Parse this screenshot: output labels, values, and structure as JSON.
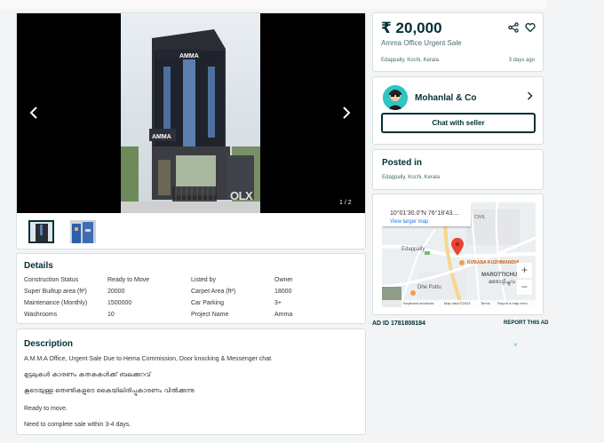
{
  "listing": {
    "price": "₹ 20,000",
    "title": "Amma Office Urgent Sale",
    "location": "Edappally, Kochi, Kerala",
    "posted_ago": "3 days ago"
  },
  "gallery": {
    "counter": "1 / 2",
    "watermark": "OLX",
    "building_sign_top": "AMMA",
    "building_sign_mid": "AMMA"
  },
  "seller": {
    "name": "Mohanlal & Co",
    "chat_label": "Chat with seller"
  },
  "posted": {
    "heading": "Posted in",
    "location": "Edappally, Kochi, Kerala"
  },
  "map": {
    "coords": "10°01'30.0\"N 76°18'43....",
    "larger_map": "View larger map",
    "place_kubaba": "KUBABA KUZHIMANDHI",
    "place_marotti": "MAROTTICHUV",
    "place_marotti_ml": "മരോട്ടിച്ചുവ",
    "place_edappally": "Edappally",
    "place_dhe": "Dhe Puttu",
    "place_civil": "CIVIL",
    "footer_shortcuts": "Keyboard shortcuts",
    "footer_data": "Map data ©2024",
    "footer_terms": "Terms",
    "footer_report": "Report a map error",
    "zoom_in": "+",
    "zoom_out": "−"
  },
  "ad": {
    "id_label": "AD ID 1781808184",
    "report_label": "REPORT THIS AD",
    "close": "×"
  },
  "details": {
    "heading": "Details",
    "left": [
      {
        "label": "Construction Status",
        "value": "Ready to Move"
      },
      {
        "label": "Super Builtup area (ft²)",
        "value": "20000"
      },
      {
        "label": "Maintenance (Monthly)",
        "value": "1500000"
      },
      {
        "label": "Washrooms",
        "value": "10"
      }
    ],
    "right": [
      {
        "label": "Listed by",
        "value": "Owner"
      },
      {
        "label": "Carpet Area (ft²)",
        "value": "18000"
      },
      {
        "label": "Car Parking",
        "value": "3+"
      },
      {
        "label": "Project Name",
        "value": "Amma"
      }
    ]
  },
  "description": {
    "heading": "Description",
    "lines": [
      "A.M.M.A Office, Urgent Sale Due to Hema Commission, Door knocking & Messenger chat.",
      "മുട്ടലുകൾ കാരണം കതകുകൾക്ക് ബലക്കുറവ്",
      "കൂടെയുള്ള തെണ്ടികളുടെ കൈയിലിരിപ്പുകാരണം വിൽക്കുന്നു",
      "Ready to move.",
      "Need to complete sale within 3-4 days."
    ]
  },
  "colors": {
    "primary": "#002f34",
    "accent": "#2ec4c4",
    "marker": "#ea4335"
  }
}
